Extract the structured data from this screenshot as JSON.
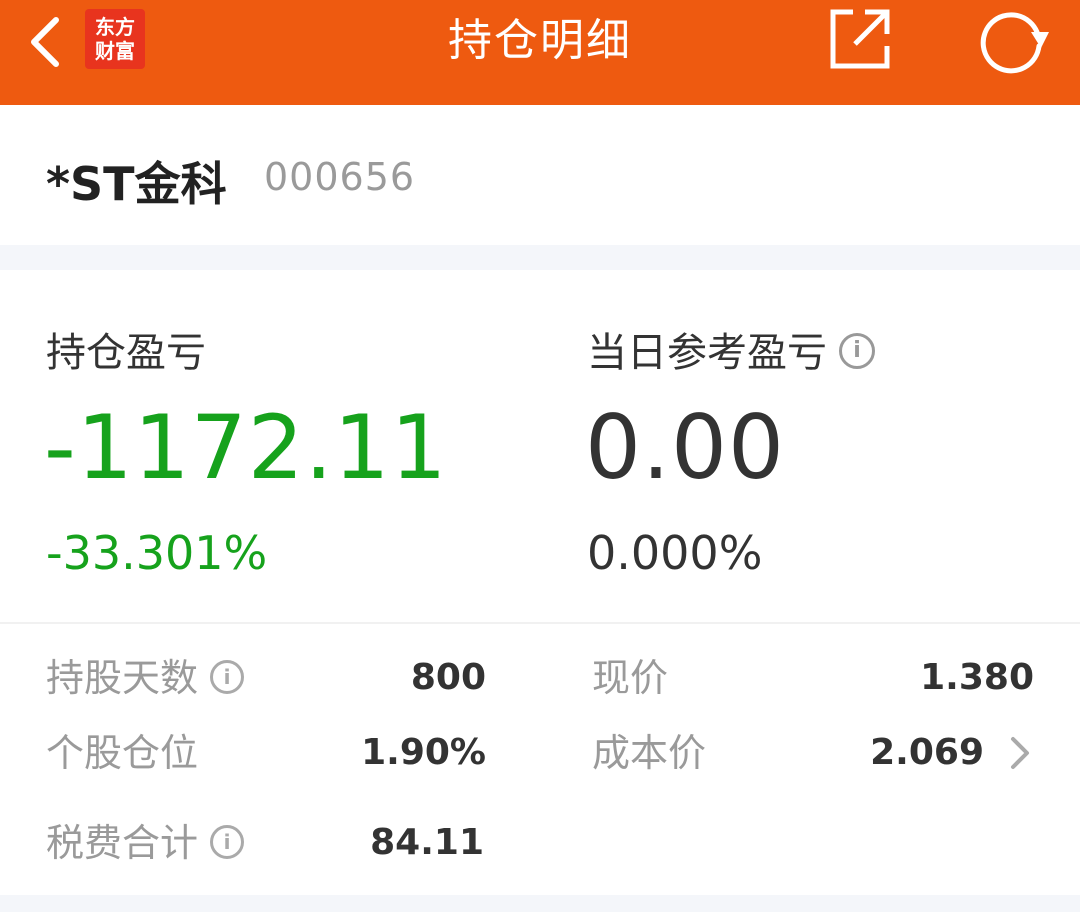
{
  "colors": {
    "brand": "#ee5a10",
    "loss": "#16a21c",
    "text": "#333333",
    "muted": "#9a9a9a"
  },
  "header": {
    "title": "持仓明细",
    "logo_line1": "东方",
    "logo_line2": "财富",
    "icons": {
      "back": "chevron-left-icon",
      "share": "share-icon",
      "refresh": "refresh-icon"
    }
  },
  "stock": {
    "name": "*ST金科",
    "code": "000656"
  },
  "pnl": {
    "holding_label": "持仓盈亏",
    "holding_value": "-1172.11",
    "holding_pct": "-33.301%",
    "daily_label": "当日参考盈亏",
    "daily_value": "0.00",
    "daily_pct": "0.000%"
  },
  "stats": {
    "holding_days_label": "持股天数",
    "holding_days_value": "800",
    "position_label": "个股仓位",
    "position_value": "1.90%",
    "fees_label": "税费合计",
    "fees_value": "84.11",
    "price_label": "现价",
    "price_value": "1.380",
    "cost_label": "成本价",
    "cost_value": "2.069"
  }
}
